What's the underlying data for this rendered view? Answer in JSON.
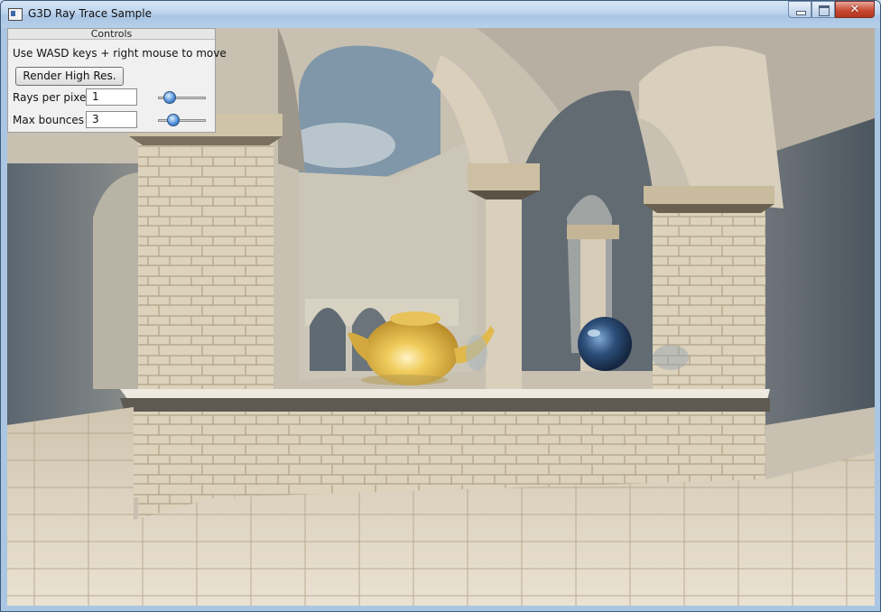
{
  "window": {
    "title": "G3D Ray Trace Sample",
    "close_glyph": "✕"
  },
  "controls": {
    "header": "Controls",
    "instructions": "Use WASD keys + right mouse to move",
    "render_button": "Render High Res.",
    "rays_label": "Rays per pixel",
    "rays_value": "1",
    "rays_slider_fraction": 0.15,
    "bounces_label": "Max bounces",
    "bounces_value": "3",
    "bounces_slider_fraction": 0.25
  },
  "colors": {
    "sky": "#7f97a8",
    "stone": "#d8cdb6",
    "teapot": "#e7c35a",
    "sphere": "#2c4e78",
    "close_button": "#c94a33"
  },
  "icons": [
    "app-icon",
    "minimize-icon",
    "maximize-icon",
    "close-icon"
  ]
}
